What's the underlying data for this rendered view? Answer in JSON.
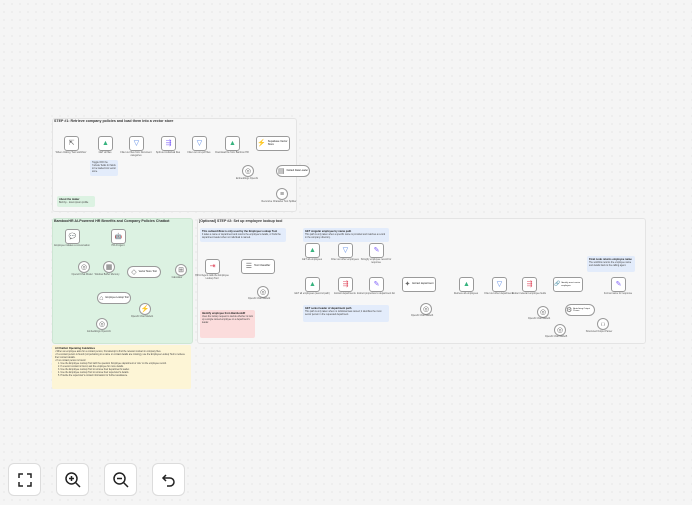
{
  "step1": {
    "title": "STEP #1: Retrieve company policies and load them into a vector store",
    "nodes": [
      {
        "label": "When clicking 'Test workflow'",
        "icon": "pointer-icon",
        "glyph": "⇱",
        "color": "gray"
      },
      {
        "label": "GET all files",
        "icon": "google-drive-icon",
        "glyph": "▲",
        "color": "green"
      },
      {
        "label": "Filter out files from Document categories",
        "icon": "filter-icon",
        "glyph": "▽",
        "color": "blue"
      },
      {
        "label": "Split out individual files",
        "icon": "split-icon",
        "glyph": "⇶",
        "color": "purple"
      },
      {
        "label": "Filter out non-pdf files",
        "icon": "filter-icon",
        "glyph": "▽",
        "color": "blue"
      },
      {
        "label": "Download file from Bamboo HR",
        "icon": "bamboohr-icon",
        "glyph": "▲",
        "color": "green"
      },
      {
        "label": "Supabase Vector Store",
        "icon": "vector-store-icon",
        "glyph": "⚡",
        "color": "green"
      },
      {
        "label": "Embeddings OpenAI",
        "icon": "openai-icon",
        "glyph": "◎",
        "color": "gray"
      },
      {
        "label": "Default Data Loader",
        "icon": "data-loader-icon",
        "glyph": "▤",
        "color": "gray"
      },
      {
        "label": "Recursive Character Text Splitter",
        "icon": "text-splitter-icon",
        "glyph": "≡",
        "color": "gray"
      }
    ],
    "note": "Toggle OFF the 'Include' fields for fields to be loaded into vector store.",
    "about_title": "About the maker",
    "about_text": "Built by... lorem ipsum profile"
  },
  "chatbot": {
    "title": "BambooHR AI-Powered HR Benefits and Company Policies Chatbot",
    "nodes": [
      {
        "label": "Employee initiates a conversation",
        "icon": "chat-trigger-icon",
        "glyph": "💬",
        "color": "gray"
      },
      {
        "label": "HR AI Agent",
        "icon": "ai-agent-icon",
        "glyph": "🤖",
        "color": "gray"
      },
      {
        "label": "OpenAI Chat Model",
        "icon": "openai-icon",
        "glyph": "◎",
        "color": "gray"
      },
      {
        "label": "Window Buffer Memory",
        "icon": "memory-icon",
        "glyph": "▦",
        "color": "gray"
      },
      {
        "label": "Vector Store Tool",
        "icon": "vector-tool-icon",
        "glyph": "◇",
        "color": "gray"
      },
      {
        "label": "Employee Lookup Tool",
        "icon": "lookup-tool-icon",
        "glyph": "⌂",
        "color": "gray"
      },
      {
        "label": "Employee Handbook Vector Retriever",
        "icon": "retriever-icon",
        "glyph": "⚡",
        "color": "green"
      },
      {
        "label": "OpenAI Chat Model1",
        "icon": "openai-icon",
        "glyph": "◎",
        "color": "gray"
      },
      {
        "label": "Embeddings OpenAI1",
        "icon": "openai-icon",
        "glyph": "◎",
        "color": "gray"
      },
      {
        "label": "Calculator",
        "icon": "calculator-icon",
        "glyph": "⊞",
        "color": "gray"
      }
    ]
  },
  "guidelines": {
    "title": "AI Chatbot Operating Guidelines",
    "lines": [
      "• When an employee asks for a contact person, first attempt to find the relevant contact in company files.",
      "• If a contact person is found (not pertaining to a name or contact details are missing), use the Employee Lookup Tool to retrieve their contact details.",
      "• If no contact person is found:",
      "1. Use the Employee Lookup Tool with the question 'Employee department or role' on the employee record.",
      "2. If a senior contact is found, ask the employee for more details.",
      "3. Use the Employee Lookup Tool to retrieve their department's leader.",
      "4. Use the Employee Lookup Tool to retrieve their supervisor's details.",
      "5. Provide the supervisor's contact information for further assistance."
    ]
  },
  "step2": {
    "title": "[Optional] STEP #2: Set up employee lookup tool",
    "note1_title": "This subworkflow is only used by the Employee Lookup Tool",
    "note1_text": "It takes a name or department and returns the employee's details, or finds the department leader when no individual is named.",
    "note2_title": "GET singular employee by name path",
    "note2_text": "This path is only taken when a specific name is provided and matches a record in the company directory.",
    "note3_title": "GET senior leader of department path",
    "note3_text": "This path is only taken when no individual was named; it identifies the most senior person in the requested department.",
    "note4_title": "Final node returns employee name",
    "note4_text": "The workflow returns the employee name and details back to the calling agent.",
    "note5_title": "Identify employee from BambooHR",
    "note5_text": "Uses the lookup request to decide whether to look up a single named employee or a department's leader.",
    "nodes": [
      {
        "label": "HR AI Agent calls the Employee Lookup Tool",
        "icon": "execute-trigger-icon",
        "glyph": "⇥",
        "color": "red"
      },
      {
        "label": "Text Classifier",
        "icon": "classifier-icon",
        "glyph": "☰",
        "color": "gray"
      },
      {
        "label": "OpenAI Chat Model2",
        "icon": "openai-icon",
        "glyph": "◎",
        "color": "gray"
      },
      {
        "label": "GET all employees",
        "icon": "bamboohr-icon",
        "glyph": "▲",
        "color": "green"
      },
      {
        "label": "Filter out other employees",
        "icon": "filter-icon",
        "glyph": "▽",
        "color": "blue"
      },
      {
        "label": "Stringify employee record for response",
        "icon": "set-icon",
        "glyph": "✎",
        "color": "purple"
      },
      {
        "label": "GET all employees (second path)",
        "icon": "bamboohr-icon",
        "glyph": "▲",
        "color": "green"
      },
      {
        "label": "Extract departments",
        "icon": "split-icon",
        "glyph": "⇶",
        "color": "red"
      },
      {
        "label": "Extract properties to department list",
        "icon": "set-icon",
        "glyph": "✎",
        "color": "purple"
      },
      {
        "label": "Extract department",
        "icon": "extract-icon",
        "glyph": "✦",
        "color": "gray"
      },
      {
        "label": "OpenAI Chat Model3",
        "icon": "openai-icon",
        "glyph": "◎",
        "color": "gray"
      },
      {
        "label": "Retrieve all employees",
        "icon": "bamboohr-icon",
        "glyph": "▲",
        "color": "green"
      },
      {
        "label": "Filter out other departments",
        "icon": "filter-icon",
        "glyph": "▽",
        "color": "blue"
      },
      {
        "label": "Extract relevant employee fields",
        "icon": "split-icon",
        "glyph": "⇶",
        "color": "red"
      },
      {
        "label": "Identify most senior employee",
        "icon": "llm-chain-icon",
        "glyph": "🔗",
        "color": "gray"
      },
      {
        "label": "OpenAI Chat Model4",
        "icon": "openai-icon",
        "glyph": "◎",
        "color": "gray"
      },
      {
        "label": "Auto-fixing Output Parser",
        "icon": "parser-icon",
        "glyph": "⚙",
        "color": "gray"
      },
      {
        "label": "OpenAI Chat Model5",
        "icon": "openai-icon",
        "glyph": "◎",
        "color": "gray"
      },
      {
        "label": "Structured Output Parser",
        "icon": "json-icon",
        "glyph": "{ }",
        "color": "gray"
      },
      {
        "label": "Format name for response",
        "icon": "set-icon",
        "glyph": "✎",
        "color": "purple"
      }
    ]
  },
  "controls": {
    "fit_view": "fit-view",
    "zoom_in": "zoom-in",
    "zoom_out": "zoom-out",
    "undo": "undo"
  },
  "colors": {
    "step1_bg": "#f7f7f7",
    "chatbot_bg": "#dcf2e2",
    "guidelines_bg": "#fdf5d6",
    "step2_bg": "#f7f7f7",
    "note_blue": "#e3ecfb",
    "note_red": "#fbdcdc",
    "accent_green": "#36b37e"
  }
}
